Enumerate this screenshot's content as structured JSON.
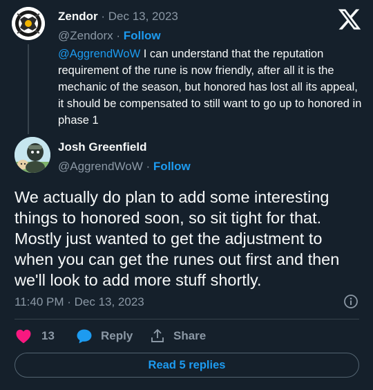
{
  "parent_tweet": {
    "name": "Zendor",
    "separator": "·",
    "date": "Dec 13, 2023",
    "handle": "@Zendorx",
    "follow_sep": "·",
    "follow_label": "Follow",
    "mention": "@AggrendWoW",
    "text": " I can understand that the reputation requirement of the rune is now friendly, after all it is the mechanic of the season, but honored has lost all its appeal, it should be compensated to still want to go up to honored in phase 1"
  },
  "main_tweet": {
    "name": "Josh Greenfield",
    "handle": "@AggrendWoW",
    "follow_sep": "·",
    "follow_label": "Follow",
    "text": "We actually do plan to add some interesting things to honored soon, so sit tight for that. Mostly just wanted to get the adjustment to when you can get the runes out first and then we'll look to add more stuff shortly.",
    "timestamp": "11:40 PM · Dec 13, 2023"
  },
  "actions": {
    "like_count": "13",
    "reply_label": "Reply",
    "share_label": "Share"
  },
  "read_replies_label": "Read 5 replies",
  "colors": {
    "background": "#15202b",
    "accent": "#1d9bf0",
    "like": "#f91880",
    "muted": "#8b98a5"
  },
  "icons": [
    "x-logo-icon",
    "info-icon",
    "heart-icon",
    "reply-bubble-icon",
    "share-icon"
  ]
}
